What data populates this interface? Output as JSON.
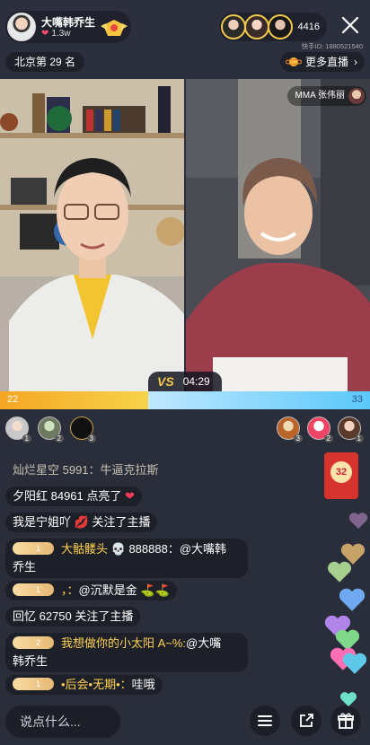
{
  "host": {
    "name": "大嘴韩乔生",
    "likes": "1.3w"
  },
  "viewers": {
    "count": "4416",
    "anchor_id": "快手ID: 1880521540"
  },
  "rank": {
    "label": "北京第 29 名"
  },
  "more_live": {
    "label": "更多直播"
  },
  "guest": {
    "name": "MMA 张伟丽"
  },
  "pk": {
    "timer": "04:29",
    "left_score": "22",
    "right_score": "33",
    "left_share": 0.4
  },
  "supporters": {
    "left": [
      {
        "rank": "1"
      },
      {
        "rank": "2"
      },
      {
        "rank": "3"
      }
    ],
    "right": [
      {
        "rank": "3"
      },
      {
        "rank": "2"
      },
      {
        "rank": "1"
      }
    ]
  },
  "chat": [
    {
      "user": "灿烂星空 5991：",
      "text": "牛逼克拉斯",
      "style": "dim"
    },
    {
      "user": "夕阳红 84961",
      "text": "点亮了",
      "icon": "heart"
    },
    {
      "user": "我是宁姐吖",
      "text": "关注了主播",
      "icon": "lips"
    },
    {
      "level": "1",
      "user": "大骷髅头",
      "icon": "skull",
      "text": "888888：@大嘴韩",
      "text2": "乔生"
    },
    {
      "level": "1",
      "user": "，：",
      "text": "@沉默是金",
      "icon": "golf"
    },
    {
      "user": "回忆 62750",
      "text": "关注了主播"
    },
    {
      "level": "2",
      "user": "我想做你的小太阳 A~%:",
      "text": "@大嘴",
      "text2": "韩乔生"
    },
    {
      "level": "1",
      "user": "•后会•无期•：",
      "text": "哇哦"
    }
  ],
  "red_packet": {
    "value": "32"
  },
  "input": {
    "placeholder": "说点什么..."
  }
}
